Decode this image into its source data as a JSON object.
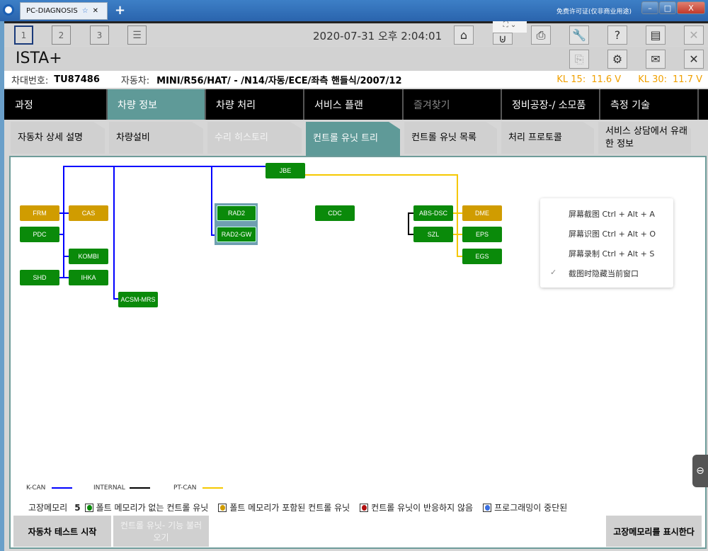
{
  "window": {
    "tab_title": "PC-DIAGNOSIS",
    "license_text": "免费许可证(仅非商业用途)",
    "min": "–",
    "max": "□",
    "close": "X"
  },
  "toolbar": {
    "sessions": [
      "1",
      "2",
      "3"
    ],
    "datetime": "2020-07-31 오후 2:04:01"
  },
  "app": {
    "title": "ISTA+"
  },
  "info": {
    "vin_label": "차대번호:",
    "vin": "TU87486",
    "vehicle_label": "자동차:",
    "vehicle": "MINI/R56/HAT/ - /N14/자동/ECE/좌측 핸들식/2007/12",
    "kl15_label": "KL 15:",
    "kl15": "11.6 V",
    "kl30_label": "KL 30:",
    "kl30": "11.7 V"
  },
  "nav": [
    {
      "label": "과정"
    },
    {
      "label": "차량 정보"
    },
    {
      "label": "차량 처리"
    },
    {
      "label": "서비스 플랜"
    },
    {
      "label": "즐겨찾기"
    },
    {
      "label": "정비공장-/ 소모품"
    },
    {
      "label": "측정 기술"
    }
  ],
  "subtabs": [
    {
      "label": "자동차 상세 설명"
    },
    {
      "label": "차량설비"
    },
    {
      "label": "수리 히스토리"
    },
    {
      "label": "컨트롤 유닛 트리"
    },
    {
      "label": "컨트롤 유닛 목록"
    },
    {
      "label": "처리 프로토콜"
    },
    {
      "label": "서비스 상담에서 유래한 정보"
    }
  ],
  "nodes": {
    "jbe": "JBE",
    "frm": "FRM",
    "cas": "CAS",
    "pdc": "PDC",
    "kombi": "KOMBI",
    "shd": "SHD",
    "ihka": "IHKA",
    "acsm": "ACSM-MRS",
    "rad2": "RAD2",
    "rad2gw": "RAD2-GW",
    "cdc": "CDC",
    "absdsc": "ABS-DSC",
    "szl": "SZL",
    "dme": "DME",
    "eps": "EPS",
    "egs": "EGS"
  },
  "colors": {
    "kcan": "#0000ff",
    "internal": "#000000",
    "ptcan": "#f5c800",
    "ok": "#0a8a0a",
    "fault": "#d09c00",
    "accent": "#5f9a98",
    "kl": "#f0a000"
  },
  "context_menu": [
    "屏幕截图 Ctrl + Alt + A",
    "屏幕识图 Ctrl + Alt + O",
    "屏幕录制 Ctrl + Alt + S",
    "截图时隐藏当前窗口"
  ],
  "legend": {
    "kcan": "K-CAN",
    "internal": "INTERNAL",
    "ptcan": "PT-CAN"
  },
  "faults": {
    "label": "고장메모리",
    "count": "5",
    "no_fault": "폴트 메모리가 없는 컨트롤 유닛",
    "with_fault": "폴트 메모리가 포함된 컨트롤 유닛",
    "no_response": "컨트롤 유닛이 반응하지 않음",
    "prog_aborted": "프로그래밍이 중단된"
  },
  "buttons": {
    "start_test": "자동차 테스트 시작",
    "call_functions": "컨트롤 유닛- 기능 불러오기",
    "show_faults": "고장메모리를 표시한다"
  }
}
